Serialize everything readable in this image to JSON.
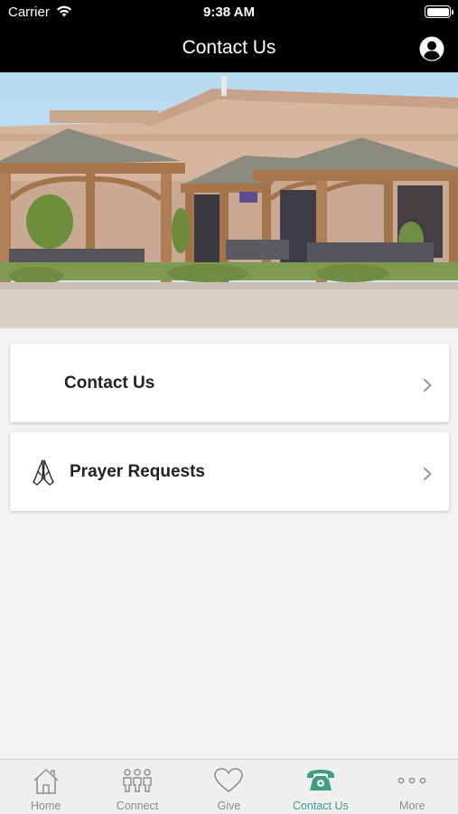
{
  "status_bar": {
    "carrier": "Carrier",
    "time": "9:38 AM"
  },
  "header": {
    "title": "Contact Us",
    "profile_icon": "person-circle-icon"
  },
  "hero": {
    "image": "church-building-with-wooden-pergolas"
  },
  "menu": [
    {
      "label": "Contact Us",
      "icon": ""
    },
    {
      "label": "Prayer Requests",
      "icon": "praying-hands-icon"
    }
  ],
  "tabs": [
    {
      "label": "Home",
      "icon": "home-icon"
    },
    {
      "label": "Connect",
      "icon": "people-icon"
    },
    {
      "label": "Give",
      "icon": "heart-icon"
    },
    {
      "label": "Contact Us",
      "icon": "telephone-icon",
      "active": true
    },
    {
      "label": "More",
      "icon": "more-dots-icon"
    }
  ],
  "colors": {
    "bar_background": "#000000",
    "accent": "#3f9d86",
    "page_background": "#f2f2f2",
    "tab_inactive": "#8c8c8c"
  }
}
